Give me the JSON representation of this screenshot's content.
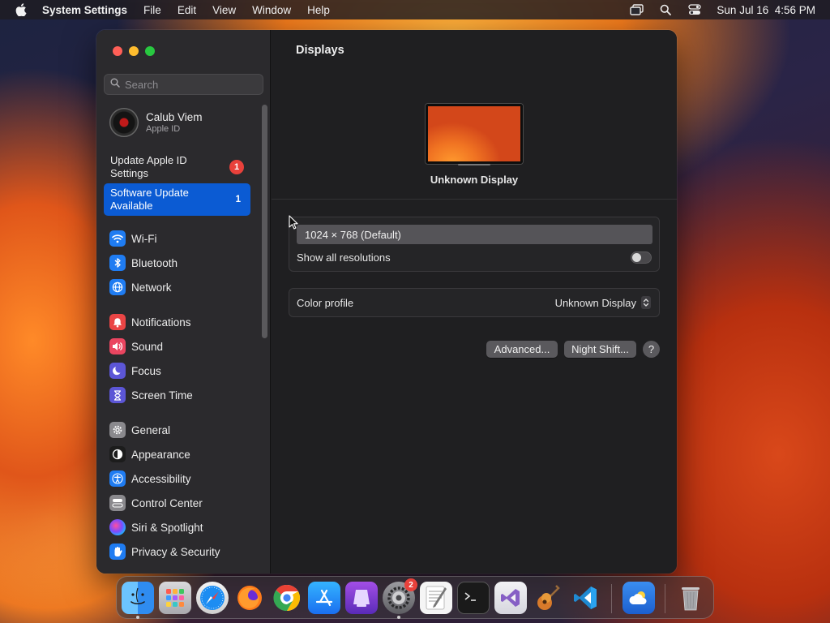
{
  "menubar": {
    "app_name": "System Settings",
    "menus": [
      "File",
      "Edit",
      "View",
      "Window",
      "Help"
    ],
    "clock": "Sun Jul 16  4:56 PM"
  },
  "sidebar": {
    "search_placeholder": "Search",
    "profile": {
      "name": "Calub Viem",
      "subtitle": "Apple ID"
    },
    "update_apple_id": {
      "label": "Update Apple ID Settings",
      "badge": "1"
    },
    "software_update": {
      "label": "Software Update Available",
      "badge": "1"
    },
    "items": [
      {
        "label": "Wi-Fi",
        "icon": "wifi-icon",
        "color": "#1f7cf2"
      },
      {
        "label": "Bluetooth",
        "icon": "bluetooth-icon",
        "color": "#1f7cf2"
      },
      {
        "label": "Network",
        "icon": "globe-icon",
        "color": "#1f7cf2"
      },
      {
        "label": "Notifications",
        "icon": "bell-icon",
        "color": "#ea4545"
      },
      {
        "label": "Sound",
        "icon": "speaker-icon",
        "color": "#ea4560"
      },
      {
        "label": "Focus",
        "icon": "moon-icon",
        "color": "#5c56d6"
      },
      {
        "label": "Screen Time",
        "icon": "hourglass-icon",
        "color": "#5c56d6"
      },
      {
        "label": "General",
        "icon": "gear-icon",
        "color": "#8a898d"
      },
      {
        "label": "Appearance",
        "icon": "appearance-icon",
        "color": "#1c1c1c"
      },
      {
        "label": "Accessibility",
        "icon": "accessibility-icon",
        "color": "#1f7cf2"
      },
      {
        "label": "Control Center",
        "icon": "control-center-icon",
        "color": "#8a898d"
      },
      {
        "label": "Siri & Spotlight",
        "icon": "siri-icon",
        "color": "#2a2a2a"
      },
      {
        "label": "Privacy & Security",
        "icon": "hand-icon",
        "color": "#1f7cf2"
      }
    ]
  },
  "main": {
    "title": "Displays",
    "display_name": "Unknown Display",
    "resolution": "1024 × 768 (Default)",
    "show_all_label": "Show all resolutions",
    "show_all_enabled": false,
    "color_profile_label": "Color profile",
    "color_profile_value": "Unknown Display",
    "advanced_button": "Advanced...",
    "night_shift_button": "Night Shift...",
    "help_button": "?"
  },
  "dock": {
    "apps": [
      "Finder",
      "Launchpad",
      "Safari",
      "Firefox",
      "Chrome",
      "App Store",
      "Simulator",
      "System Settings",
      "TextEdit",
      "Terminal",
      "Visual Studio",
      "Instruments",
      "VS Code",
      "Weather",
      "Trash"
    ],
    "system_settings_badge": "2"
  }
}
